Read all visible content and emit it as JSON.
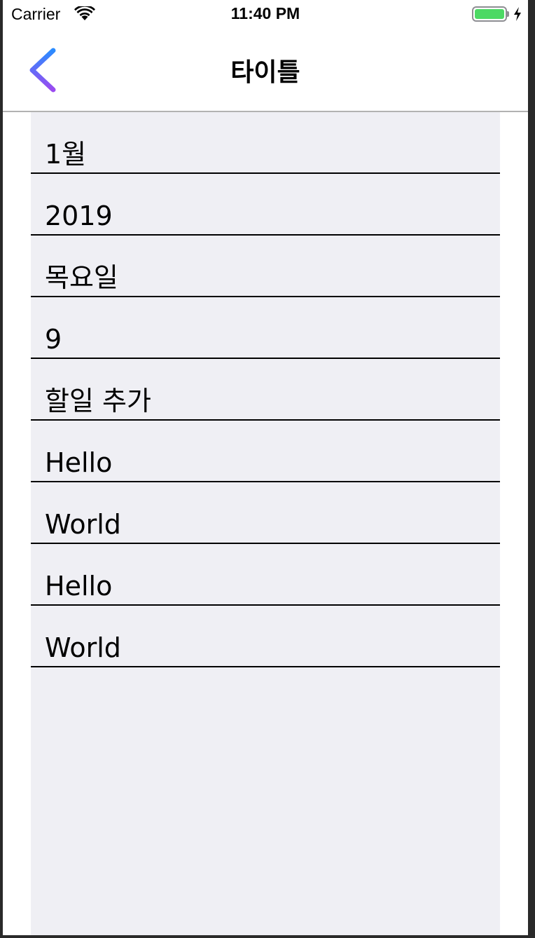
{
  "status_bar": {
    "carrier": "Carrier",
    "time": "11:40 PM",
    "battery_level": 1.0,
    "charging": true,
    "battery_color": "#4cd964"
  },
  "nav": {
    "title": "타이틀",
    "back_icon": "chevron-left-icon",
    "back_gradient": [
      "#2b8cff",
      "#9b4bf0"
    ]
  },
  "list": {
    "rows": [
      {
        "label": "1월"
      },
      {
        "label": "2019"
      },
      {
        "label": "목요일"
      },
      {
        "label": "9"
      },
      {
        "label": "할일 추가"
      },
      {
        "label": "Hello"
      },
      {
        "label": "World"
      },
      {
        "label": "Hello"
      },
      {
        "label": "World"
      }
    ]
  }
}
